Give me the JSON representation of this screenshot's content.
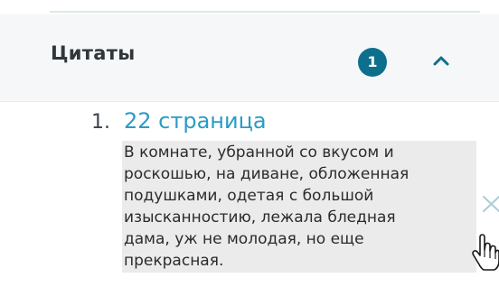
{
  "quotes_section": {
    "title": "Цитаты",
    "count": "1",
    "toggle_icon": "chevron-up-icon"
  },
  "quotes": [
    {
      "number": "1.",
      "page_link": "22 страница",
      "text": "В комнате, убранной со вкусом и\nроскошью, на диване, обложенная\nподушками, одетая с большой\nизысканностию, лежала бледная\nдама, уж не молодая, но еще\nпрекрасная.",
      "remove_icon": "close-icon"
    }
  ],
  "cursor": "hand-pointer-cursor",
  "colors": {
    "badge": "#0e6f8d",
    "link": "#2a9cc6",
    "header_background": "#f5f7f9",
    "quote_highlight": "#ebebeb"
  }
}
